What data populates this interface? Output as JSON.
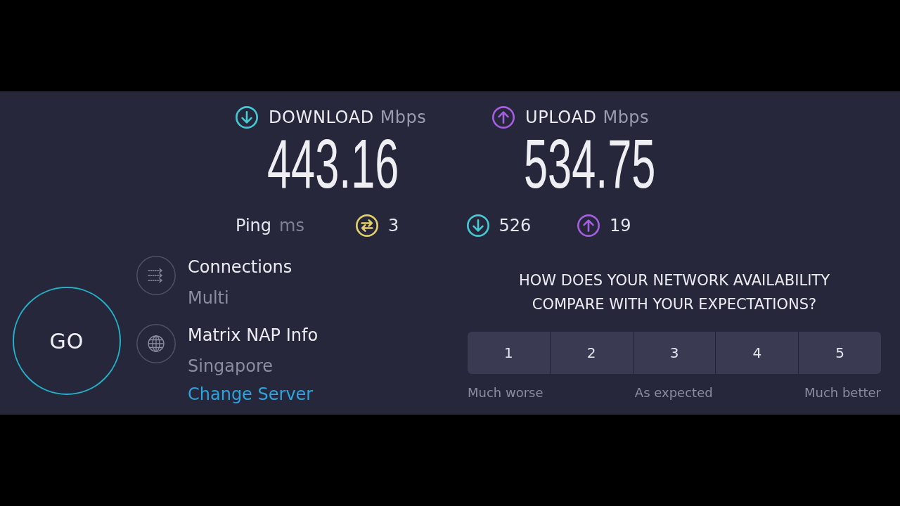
{
  "metrics": [
    {
      "kind": "download",
      "label": "DOWNLOAD",
      "unit": "Mbps",
      "value": "443.16",
      "color": "#45c9d2"
    },
    {
      "kind": "upload",
      "label": "UPLOAD",
      "unit": "Mbps",
      "value": "534.75",
      "color": "#a55fe0"
    }
  ],
  "ping": {
    "label": "Ping",
    "unit": "ms",
    "readings": [
      {
        "kind": "idle",
        "value": "3",
        "color": "#e3d06b"
      },
      {
        "kind": "download",
        "value": "526",
        "color": "#45c9d2"
      },
      {
        "kind": "upload",
        "value": "19",
        "color": "#a55fe0"
      }
    ]
  },
  "go_button": {
    "label": "GO"
  },
  "server_info": [
    {
      "kind": "connections",
      "title": "Connections",
      "value": "Multi"
    },
    {
      "kind": "server",
      "title": "Matrix NAP Info",
      "value": "Singapore",
      "link": "Change Server"
    }
  ],
  "survey": {
    "question": "HOW DOES YOUR NETWORK AVAILABILITY COMPARE WITH YOUR EXPECTATIONS?",
    "options": [
      {
        "label": "1",
        "selected": false
      },
      {
        "label": "2",
        "selected": false
      },
      {
        "label": "3",
        "selected": false
      },
      {
        "label": "4",
        "selected": false
      },
      {
        "label": "5",
        "selected": false
      }
    ],
    "scale_labels": [
      "Much worse",
      "As expected",
      "Much better"
    ]
  }
}
